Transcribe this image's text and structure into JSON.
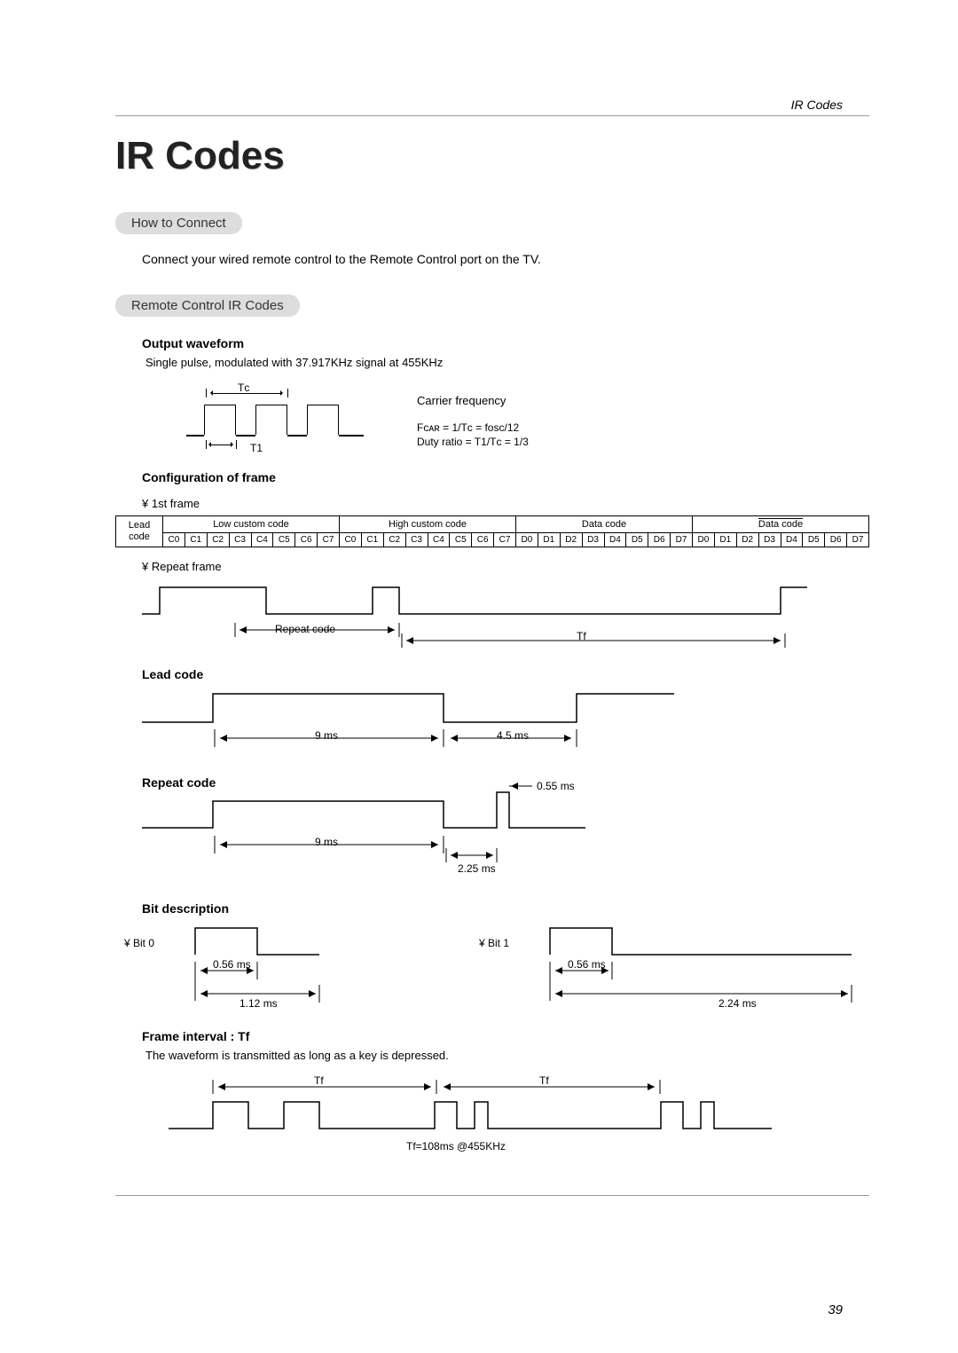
{
  "header": {
    "running_title": "IR Codes"
  },
  "title": "IR Codes",
  "sections": {
    "how_to_connect": {
      "heading": "How to Connect",
      "text": "Connect your wired remote control to the Remote Control port on the TV."
    },
    "ir_codes": {
      "heading": "Remote Control IR Codes",
      "output_waveform": {
        "heading": "Output waveform",
        "desc": "Single pulse, modulated with 37.917KHz signal at 455KHz",
        "tc_label": "Tᴄ",
        "t1_label": "T1",
        "carrier_label": "Carrier frequency",
        "formula1": "Fᴄᴀʀ = 1/Tᴄ = fosc/12",
        "formula2": "Duty ratio = T1/Tᴄ = 1/3"
      },
      "frame_config": {
        "heading": "Configuration of frame",
        "first_frame_label": "¥ 1st frame",
        "lead_label": "Lead code",
        "groups": [
          {
            "label": "Low custom code",
            "cells": [
              "C0",
              "C1",
              "C2",
              "C3",
              "C4",
              "C5",
              "C6",
              "C7"
            ]
          },
          {
            "label": "High custom code",
            "cells": [
              "C0",
              "C1",
              "C2",
              "C3",
              "C4",
              "C5",
              "C6",
              "C7"
            ]
          },
          {
            "label": "Data code",
            "cells": [
              "D0",
              "D1",
              "D2",
              "D3",
              "D4",
              "D5",
              "D6",
              "D7"
            ]
          },
          {
            "label_overline": "Data code",
            "cells": [
              "D0",
              "D1",
              "D2",
              "D3",
              "D4",
              "D5",
              "D6",
              "D7"
            ]
          }
        ],
        "repeat_frame_label": "¥ Repeat frame",
        "repeat_code_span_label": "Repeat code",
        "tf_label": "Tf"
      },
      "lead_code": {
        "heading": "Lead code",
        "t_high": "9 ms",
        "t_low": "4.5 ms"
      },
      "repeat_code": {
        "heading": "Repeat code",
        "t_high": "9 ms",
        "t_gap": "2.25 ms",
        "t_pulse": "0.55 ms"
      },
      "bit_desc": {
        "heading": "Bit description",
        "bit0_label": "¥ Bit  0",
        "bit1_label": "¥ Bit  1",
        "bit0_pulse": "0.56 ms",
        "bit0_total": "1.12 ms",
        "bit1_pulse": "0.56 ms",
        "bit1_total": "2.24 ms"
      },
      "frame_interval": {
        "heading": "Frame interval : Tf",
        "desc": "The waveform is transmitted as long as a key is depressed.",
        "tf_label": "Tf",
        "tf_value": "Tf=108ms @455KHz"
      }
    }
  },
  "page_number": "39"
}
